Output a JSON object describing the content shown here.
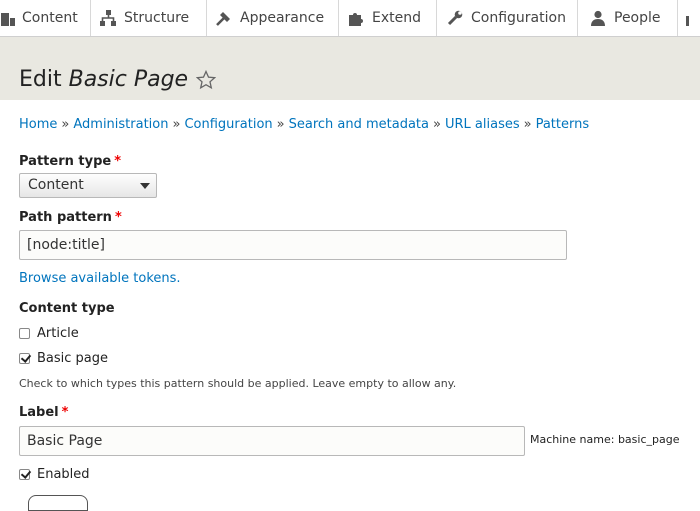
{
  "toolbar": {
    "items": [
      {
        "label": "Content",
        "icon": "content-icon"
      },
      {
        "label": "Structure",
        "icon": "structure-icon"
      },
      {
        "label": "Appearance",
        "icon": "appearance-icon"
      },
      {
        "label": "Extend",
        "icon": "extend-icon"
      },
      {
        "label": "Configuration",
        "icon": "configuration-icon"
      },
      {
        "label": "People",
        "icon": "people-icon"
      }
    ]
  },
  "header": {
    "title_prefix": "Edit",
    "title_italic": "Basic Page",
    "star_icon": "star-icon"
  },
  "breadcrumb": [
    "Home",
    "Administration",
    "Configuration",
    "Search and metadata",
    "URL aliases",
    "Patterns"
  ],
  "breadcrumb_separator": "»",
  "form": {
    "pattern_type": {
      "label": "Pattern type",
      "required_mark": "*",
      "value": "Content"
    },
    "path_pattern": {
      "label": "Path pattern",
      "required_mark": "*",
      "value": "[node:title]"
    },
    "browse_tokens": "Browse available tokens.",
    "content_type": {
      "label": "Content type",
      "options": [
        {
          "label": "Article",
          "checked": false
        },
        {
          "label": "Basic page",
          "checked": true
        }
      ],
      "description": "Check to which types this pattern should be applied. Leave empty to allow any."
    },
    "label_field": {
      "label": "Label",
      "required_mark": "*",
      "value": "Basic Page",
      "machine_name": "Machine name: basic_page"
    },
    "enabled": {
      "label": "Enabled",
      "checked": true
    }
  },
  "colors": {
    "link": "#0074bd",
    "header_bg": "#e9e8e1",
    "required": "#e00000"
  }
}
